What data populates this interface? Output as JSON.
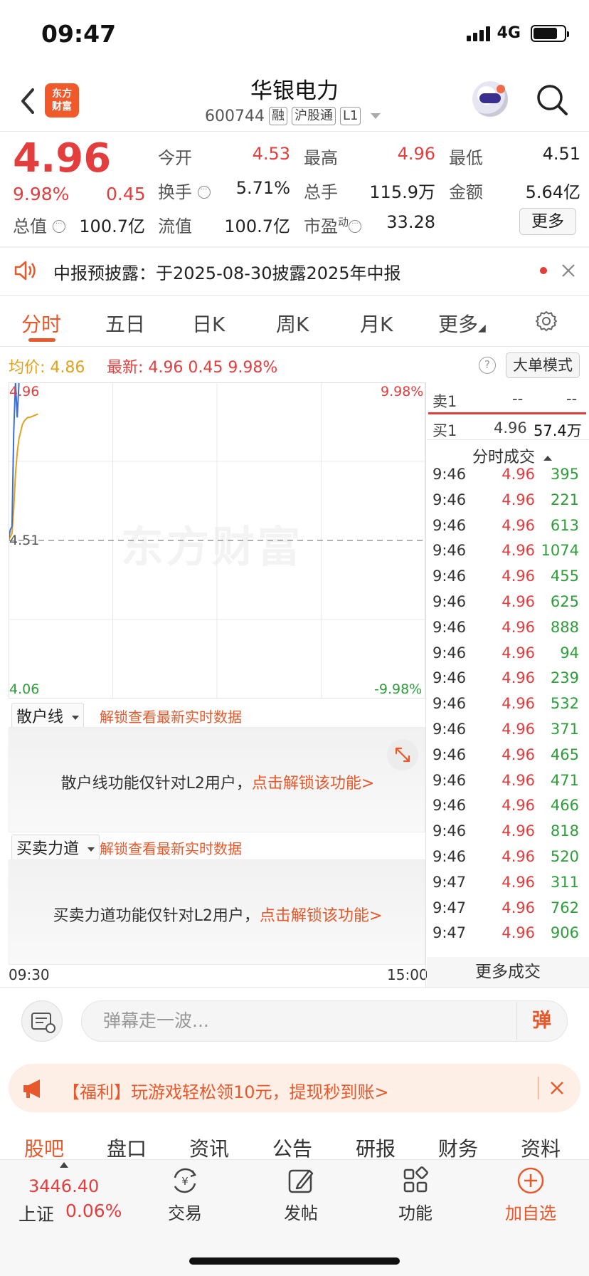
{
  "status": {
    "time": "09:47",
    "network": "4G"
  },
  "header": {
    "logo_text_line1": "东方",
    "logo_text_line2": "财富",
    "title": "华银电力",
    "code": "600744",
    "tags": [
      "融",
      "沪股通",
      "L1"
    ]
  },
  "quote": {
    "price": "4.96",
    "change_pct": "9.98%",
    "change": "0.45",
    "stats": [
      {
        "label": "今开",
        "value": "4.53",
        "color": "red"
      },
      {
        "label": "最高",
        "value": "4.96",
        "color": "red"
      },
      {
        "label": "最低",
        "value": "4.51",
        "color": "black"
      },
      {
        "label": "换手",
        "value": "5.71%",
        "color": "black"
      },
      {
        "label": "总手",
        "value": "115.9万",
        "color": "black"
      },
      {
        "label": "金额",
        "value": "5.64亿",
        "color": "black"
      },
      {
        "label": "总值",
        "value": "100.7亿",
        "color": "black"
      },
      {
        "label": "流值",
        "value": "100.7亿",
        "color": "black"
      },
      {
        "label": "市盈",
        "value": "33.28",
        "color": "black"
      }
    ],
    "pe_superscript": "动",
    "more_label": "更多"
  },
  "notice": {
    "text": "中报预披露：于2025-08-30披露2025年中报"
  },
  "tabs": {
    "items": [
      "分时",
      "五日",
      "日K",
      "周K",
      "月K",
      "更多"
    ],
    "active": 0
  },
  "infoline": {
    "avg_label": "均价:",
    "avg_value": "4.86",
    "latest_label": "最新:",
    "latest_value": "4.96",
    "latest_change": "0.45",
    "latest_pct": "9.98%",
    "help": "?",
    "big_order_label": "大单模式"
  },
  "chart_data": {
    "type": "line",
    "y_top": "4.96",
    "y_mid": "4.51",
    "y_bottom": "4.06",
    "pct_top": "9.98%",
    "pct_bottom": "-9.98%",
    "ylim": [
      4.06,
      4.96
    ],
    "prev_close": 4.51,
    "x_start": "09:30",
    "x_end": "15:00",
    "watermark": "东方财富",
    "series": [
      {
        "color": "#3c6fd6",
        "x": [
          0,
          1,
          2,
          3,
          4,
          5,
          6,
          7,
          8,
          9,
          10,
          11,
          12,
          13,
          14,
          15,
          16,
          17
        ],
        "values": [
          4.51,
          4.54,
          4.55,
          4.82,
          4.96,
          4.86,
          4.96,
          4.96,
          4.96,
          4.96,
          4.96,
          4.96,
          4.96,
          4.96,
          4.96,
          4.96,
          4.96,
          4.96
        ]
      },
      {
        "color": "#e0a21c",
        "x": [
          0,
          1,
          2,
          3,
          4,
          5,
          6,
          7,
          8,
          9,
          10,
          11,
          12,
          13,
          14,
          15,
          16,
          17
        ],
        "values": [
          4.51,
          4.52,
          4.53,
          4.6,
          4.7,
          4.76,
          4.8,
          4.82,
          4.84,
          4.85,
          4.855,
          4.86,
          4.86,
          4.862,
          4.864,
          4.866,
          4.868,
          4.87
        ]
      }
    ],
    "total_points": 241
  },
  "panels": {
    "retail_dropdown": "散户线",
    "retail_unlock": "解锁查看最新实时数据",
    "retail_msg": "散户线功能仅针对L2用户，",
    "retail_link": "点击解锁该功能>",
    "force_dropdown": "买卖力道",
    "force_unlock": "解锁查看最新实时数据",
    "force_msg": "买卖力道功能仅针对L2用户，",
    "force_link": "点击解锁该功能>"
  },
  "orderbook": {
    "sell_label": "卖1",
    "sell_price": "--",
    "sell_vol": "--",
    "buy_label": "买1",
    "buy_price": "4.96",
    "buy_vol": "57.4万"
  },
  "trades": {
    "title": "分时成交",
    "rows": [
      {
        "t": "9:46",
        "p": "4.96",
        "v": "395"
      },
      {
        "t": "9:46",
        "p": "4.96",
        "v": "221"
      },
      {
        "t": "9:46",
        "p": "4.96",
        "v": "613"
      },
      {
        "t": "9:46",
        "p": "4.96",
        "v": "1074"
      },
      {
        "t": "9:46",
        "p": "4.96",
        "v": "455"
      },
      {
        "t": "9:46",
        "p": "4.96",
        "v": "625"
      },
      {
        "t": "9:46",
        "p": "4.96",
        "v": "888"
      },
      {
        "t": "9:46",
        "p": "4.96",
        "v": "94"
      },
      {
        "t": "9:46",
        "p": "4.96",
        "v": "239"
      },
      {
        "t": "9:46",
        "p": "4.96",
        "v": "532"
      },
      {
        "t": "9:46",
        "p": "4.96",
        "v": "371"
      },
      {
        "t": "9:46",
        "p": "4.96",
        "v": "465"
      },
      {
        "t": "9:46",
        "p": "4.96",
        "v": "471"
      },
      {
        "t": "9:46",
        "p": "4.96",
        "v": "466"
      },
      {
        "t": "9:46",
        "p": "4.96",
        "v": "818"
      },
      {
        "t": "9:46",
        "p": "4.96",
        "v": "520"
      },
      {
        "t": "9:47",
        "p": "4.96",
        "v": "311"
      },
      {
        "t": "9:47",
        "p": "4.96",
        "v": "762"
      },
      {
        "t": "9:47",
        "p": "4.96",
        "v": "906"
      }
    ],
    "more_label": "更多成交"
  },
  "danmaku": {
    "placeholder": "弹幕走一波...",
    "button": "弹"
  },
  "promo": {
    "text": "【福利】玩游戏轻松领10元，提现秒到账>"
  },
  "bottom_tabs": {
    "items": [
      "股吧",
      "盘口",
      "资讯",
      "公告",
      "研报",
      "财务",
      "资料"
    ],
    "active": 0
  },
  "nav": {
    "index_value": "3446.40",
    "index_name": "上证",
    "index_pct": "0.06%",
    "items": [
      "交易",
      "发帖",
      "功能",
      "加自选"
    ]
  },
  "colors": {
    "up": "#e43d3d",
    "down": "#2e9e3a",
    "accent": "#e8582a",
    "avg_line": "#e0a21c",
    "price_line": "#3c6fd6"
  }
}
